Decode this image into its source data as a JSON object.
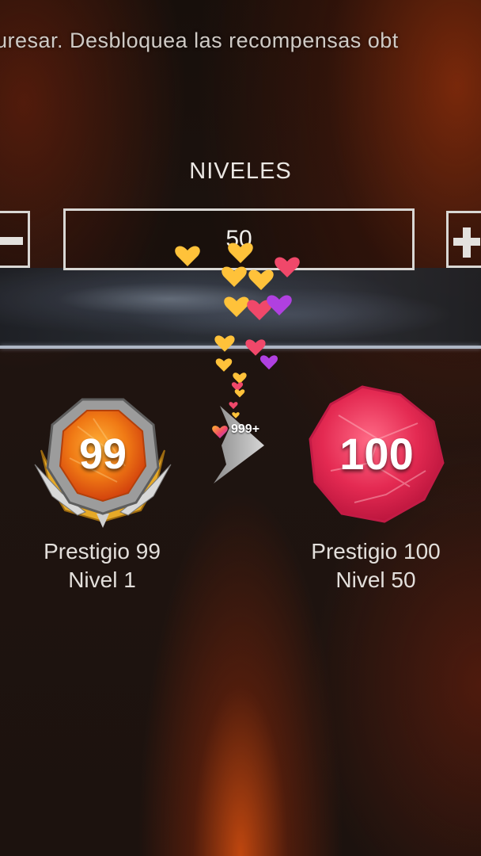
{
  "ticker": {
    "text": "uresar. Desbloquea las recompensas obt"
  },
  "levels": {
    "label": "NIVELES",
    "value": "50",
    "decrement_icon": "minus-icon",
    "increment_icon": "plus-icon"
  },
  "current": {
    "badge_number": "99",
    "prestige_label": "Prestigio 99",
    "level_label": "Nivel 1"
  },
  "target": {
    "badge_number": "100",
    "prestige_label": "Prestigio 100",
    "level_label": "Nivel 50"
  },
  "reactions": {
    "count": "999+",
    "icon": "heart-icon"
  },
  "colors": {
    "badge_99_core": "#f08a1a",
    "badge_100_core": "#e0294f",
    "heart_yellow": "#ffc23a",
    "heart_pink": "#f0486a",
    "heart_purple": "#b040e0"
  }
}
